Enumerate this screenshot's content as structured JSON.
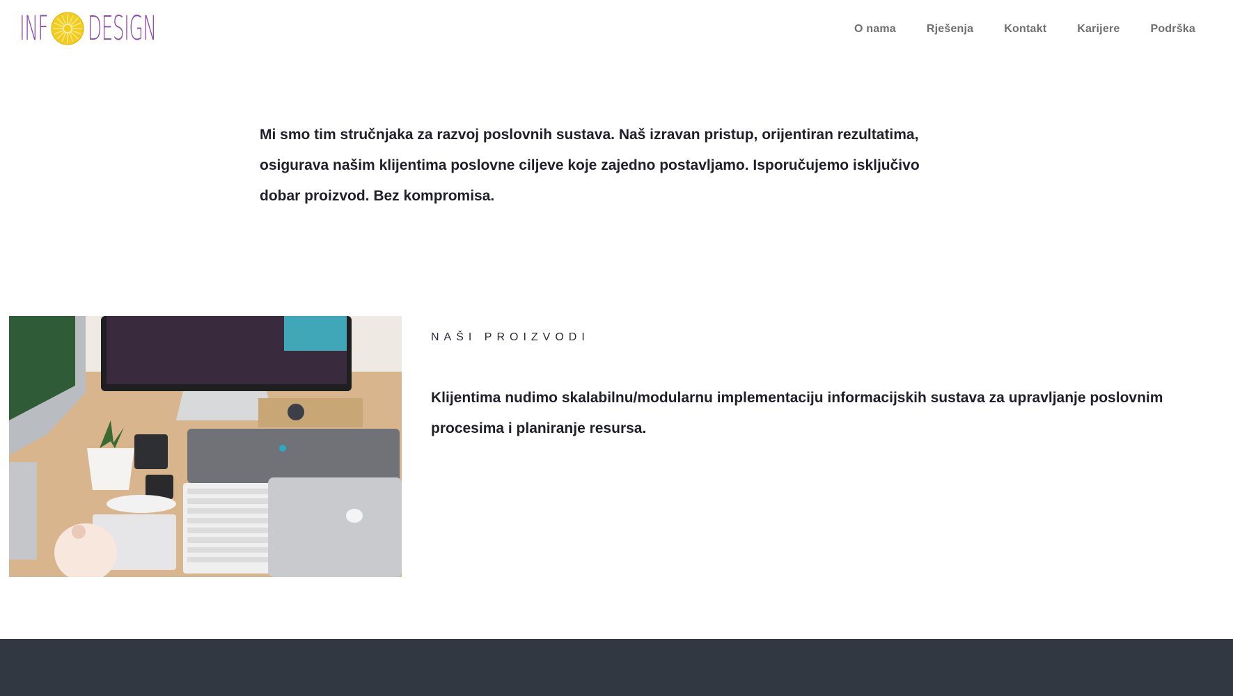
{
  "brand": {
    "logo_text_left": "INF",
    "logo_text_right": "DESIGN",
    "logo_color": "#8e4bb0",
    "flower_color": "#f3cd1d"
  },
  "nav": {
    "items": [
      {
        "label": "O nama"
      },
      {
        "label": "Rješenja"
      },
      {
        "label": "Kontakt"
      },
      {
        "label": "Karijere"
      },
      {
        "label": "Podrška"
      }
    ]
  },
  "intro": {
    "text": "Mi smo tim stručnjaka za razvoj poslovnih sustava. Naš izravan pristup, orijentiran rezultatima, osigurava našim klijentima poslovne ciljeve koje zajedno postavljamo. Isporučujemo isključivo dobar proizvod. Bez kompromisa."
  },
  "products": {
    "label": "NAŠI PROIZVODI",
    "text": "Klijentima nudimo skalabilnu/modularnu implementaciju informacijskih sustava za upravljanje poslovnim procesima i planiranje resursa.",
    "image_icon": "desk-workspace-photo"
  },
  "footer": {
    "background": "#323841"
  }
}
